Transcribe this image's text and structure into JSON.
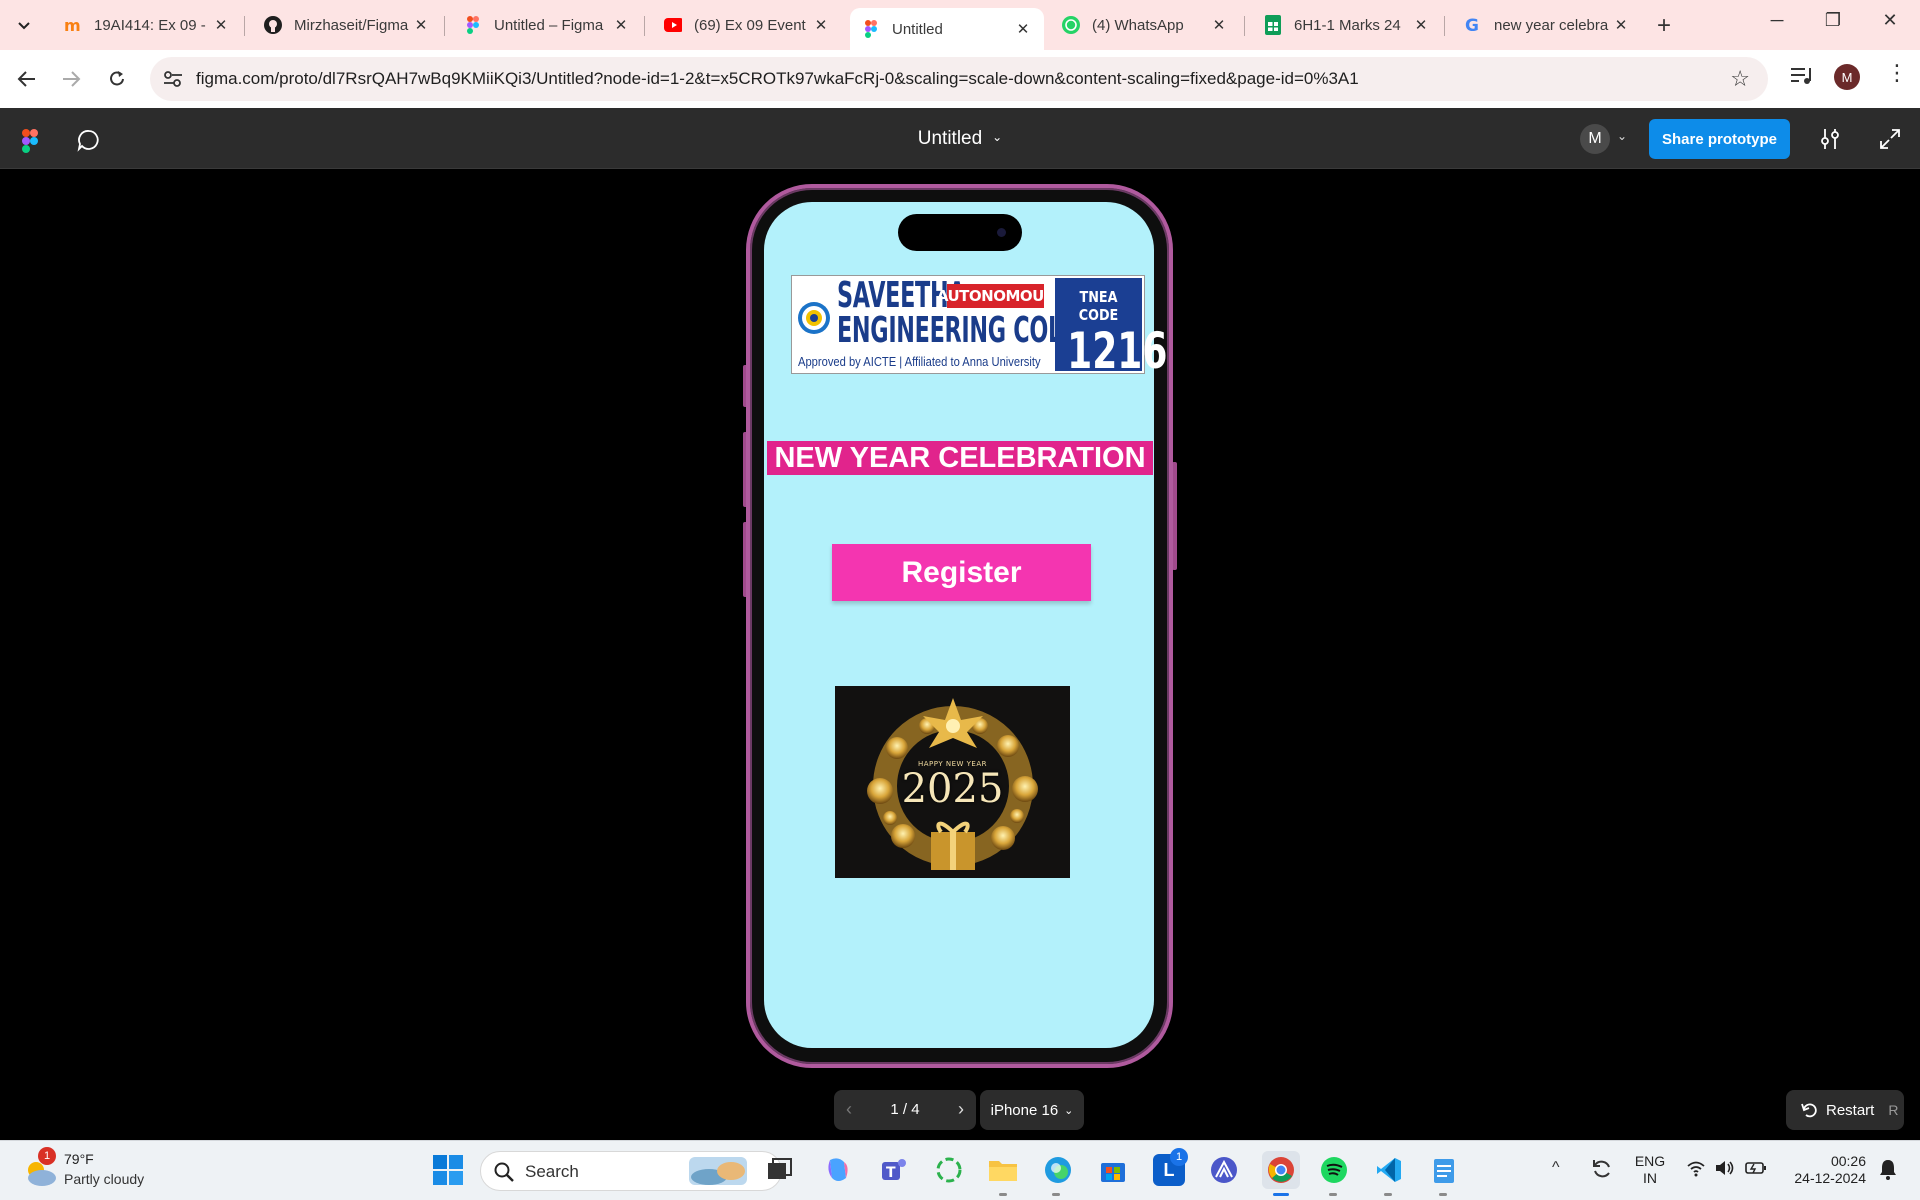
{
  "browser": {
    "tabs": [
      {
        "title": "19AI414: Ex 09 -",
        "icon": "moodle-icon"
      },
      {
        "title": "Mirzhaseit/Figma",
        "icon": "github-icon"
      },
      {
        "title": "Untitled – Figma",
        "icon": "figma-icon"
      },
      {
        "title": "(69) Ex 09 Event",
        "icon": "youtube-icon"
      },
      {
        "title": "Untitled",
        "icon": "figma-icon"
      },
      {
        "title": "(4) WhatsApp",
        "icon": "whatsapp-icon"
      },
      {
        "title": "6H1-1 Marks 24",
        "icon": "sheets-icon"
      },
      {
        "title": "new year celebra",
        "icon": "google-icon"
      }
    ],
    "url": "figma.com/proto/dl7RsrQAH7wBq9KMiiKQi3/Untitled?node-id=1-2&t=x5CROTk97wkaFcRj-0&scaling=scale-down&content-scaling=fixed&page-id=0%3A1",
    "profile_initial": "M"
  },
  "figma": {
    "file_title": "Untitled",
    "avatar_initial": "M",
    "share_label": "Share prototype",
    "page_indicator": "1 / 4",
    "device_label": "iPhone 16",
    "restart_label": "Restart",
    "restart_key": "R"
  },
  "prototype": {
    "college_line1": "SAVEETHA",
    "college_line2": "ENGINEERING COLLEGE",
    "autonomous": "AUTONOMOUS",
    "approved": "Approved by AICTE | Affiliated to Anna University",
    "tnea_label": "TNEA CODE",
    "tnea_code": "1216",
    "banner_text": "NEW YEAR CELEBRATION",
    "register_label": "Register",
    "image_caption_small": "HAPPY NEW YEAR",
    "image_year": "2025",
    "colors": {
      "screen_bg": "#b3f1fb",
      "banner": "#e1248c",
      "button": "#f435b0"
    }
  },
  "taskbar": {
    "weather_temp": "79°F",
    "weather_cond": "Partly cloudy",
    "weather_badge": "1",
    "search_label": "Search",
    "lang_line1": "ENG",
    "lang_line2": "IN",
    "time": "00:26",
    "date": "24-12-2024",
    "notif_badge": "1"
  }
}
